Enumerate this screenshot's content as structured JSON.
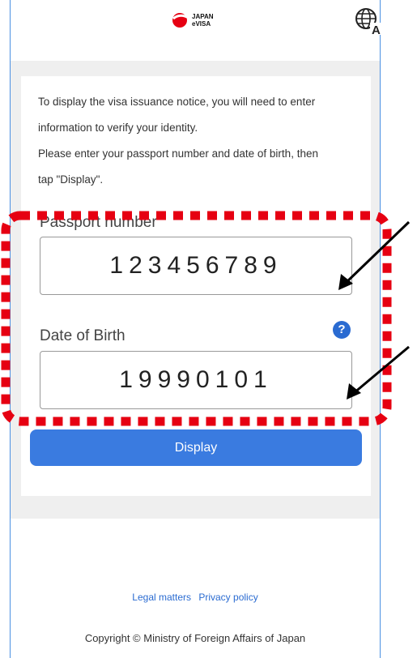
{
  "header": {
    "logo_line1": "JAPAN",
    "logo_line2": "eVISA",
    "language_icon": "globe-translate-icon"
  },
  "intro": {
    "line1": "To display the visa issuance notice, you will need to enter",
    "line2": "information to verify your identity.",
    "line3": "Please enter your passport number and date of birth, then",
    "line4": "tap \"Display\"."
  },
  "form": {
    "passport_label": "Passport number",
    "passport_value": "123456789",
    "dob_label": "Date of Birth",
    "dob_value": "19990101",
    "help_icon": "question-icon",
    "help_glyph": "?",
    "display_label": "Display"
  },
  "footer": {
    "legal_label": "Legal matters",
    "privacy_label": "Privacy policy",
    "copyright": "Copyright © Ministry of Foreign Affairs of Japan"
  },
  "colors": {
    "accent": "#3a7be0",
    "annotation": "#e60012",
    "background_band": "#efefef"
  }
}
